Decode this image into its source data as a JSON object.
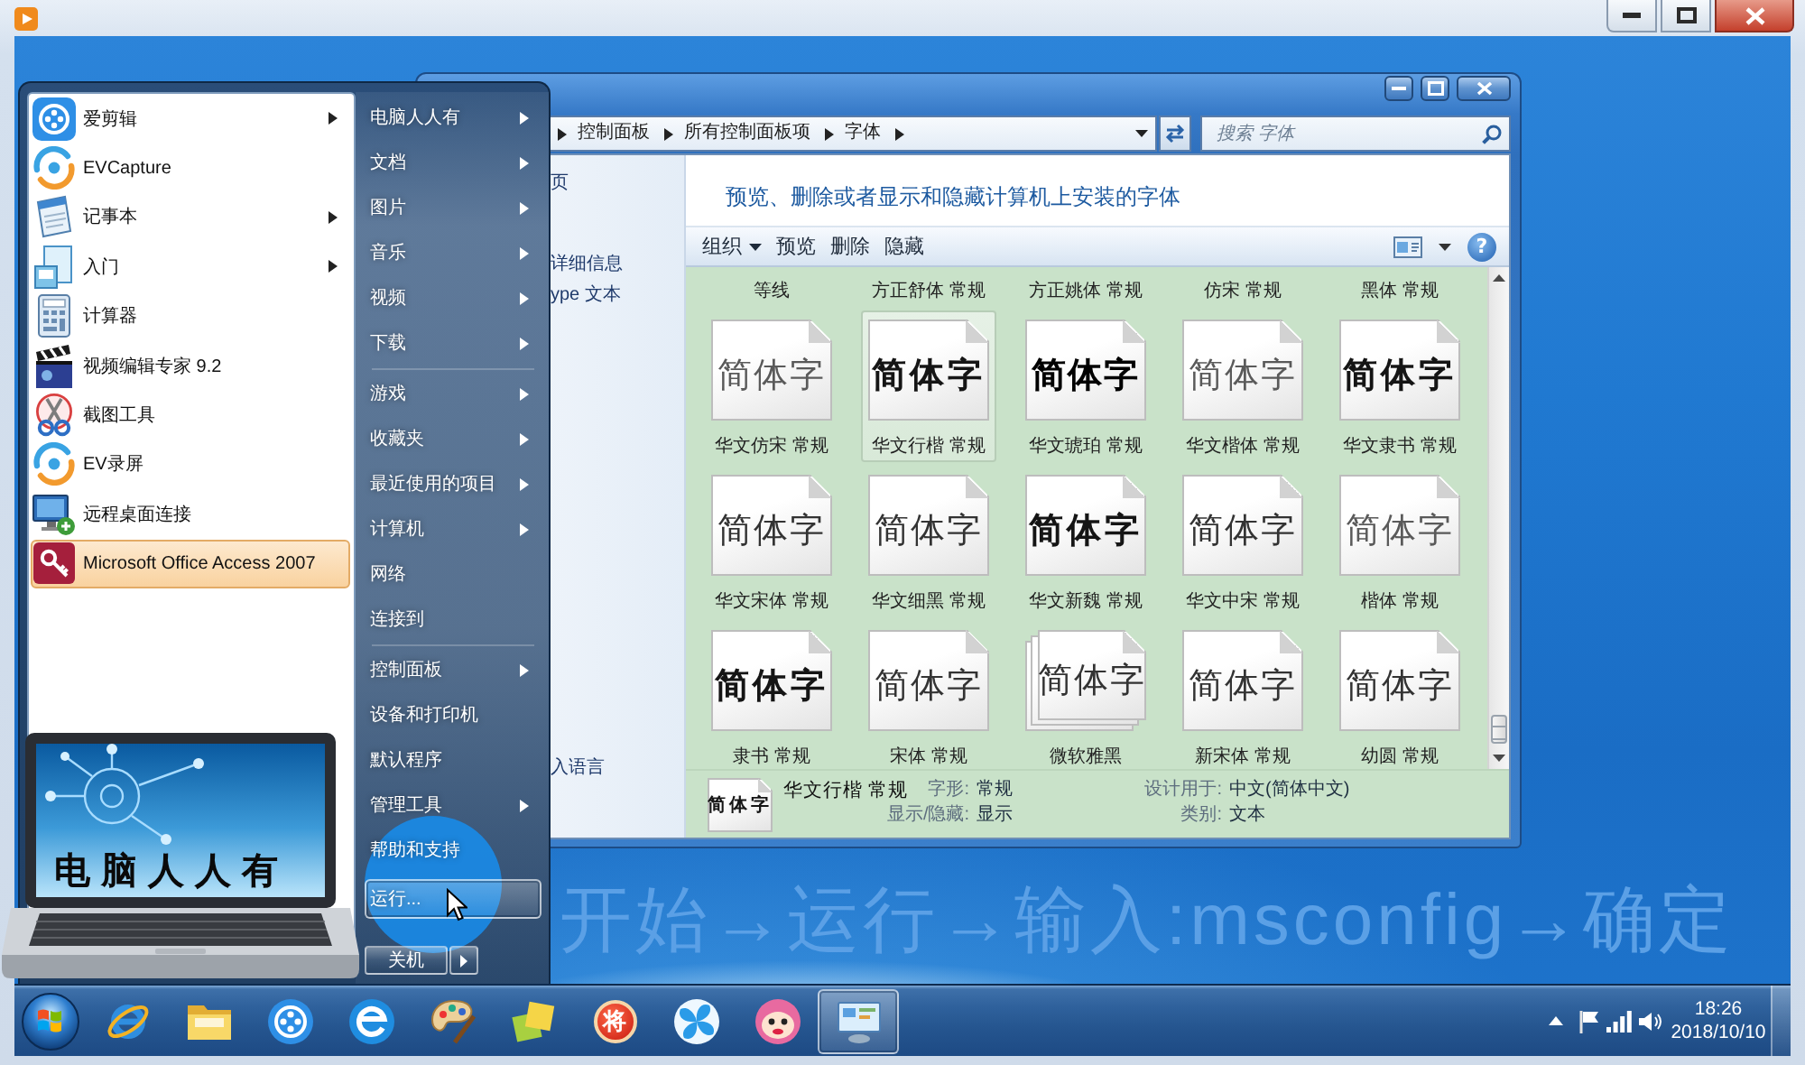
{
  "start_menu": {
    "programs": [
      {
        "label": "爱剪辑",
        "kind": "reel",
        "submenu": true,
        "selected": false
      },
      {
        "label": "EVCapture",
        "kind": "swirl",
        "submenu": false,
        "selected": false
      },
      {
        "label": "记事本",
        "kind": "notepad",
        "submenu": true,
        "selected": false
      },
      {
        "label": "入门",
        "kind": "welcome",
        "submenu": true,
        "selected": false
      },
      {
        "label": "计算器",
        "kind": "calculator",
        "submenu": false,
        "selected": false
      },
      {
        "label": "视频编辑专家 9.2",
        "kind": "clapper",
        "submenu": false,
        "selected": false
      },
      {
        "label": "截图工具",
        "kind": "scissors",
        "submenu": false,
        "selected": false
      },
      {
        "label": "EV录屏",
        "kind": "swirl",
        "submenu": false,
        "selected": false
      },
      {
        "label": "远程桌面连接",
        "kind": "monitor",
        "submenu": false,
        "selected": false
      },
      {
        "label": "Microsoft Office Access 2007",
        "kind": "key",
        "submenu": false,
        "selected": true
      }
    ],
    "place_groups": [
      {
        "items": [
          {
            "label": "电脑人人有",
            "submenu": true,
            "selected": false
          },
          {
            "label": "文档",
            "submenu": true,
            "selected": false
          },
          {
            "label": "图片",
            "submenu": true,
            "selected": false
          },
          {
            "label": "音乐",
            "submenu": true,
            "selected": false
          },
          {
            "label": "视频",
            "submenu": true,
            "selected": false
          },
          {
            "label": "下载",
            "submenu": true,
            "selected": false
          }
        ]
      },
      {
        "items": [
          {
            "label": "游戏",
            "submenu": true,
            "selected": false
          },
          {
            "label": "收藏夹",
            "submenu": true,
            "selected": false
          },
          {
            "label": "最近使用的项目",
            "submenu": true,
            "selected": false
          },
          {
            "label": "计算机",
            "submenu": true,
            "selected": false
          },
          {
            "label": "网络",
            "submenu": false,
            "selected": false
          },
          {
            "label": "连接到",
            "submenu": false,
            "selected": false
          }
        ]
      },
      {
        "items": [
          {
            "label": "控制面板",
            "submenu": true,
            "selected": false
          },
          {
            "label": "设备和打印机",
            "submenu": false,
            "selected": false
          },
          {
            "label": "默认程序",
            "submenu": false,
            "selected": false
          },
          {
            "label": "管理工具",
            "submenu": true,
            "selected": false
          },
          {
            "label": "帮助和支持",
            "submenu": false,
            "selected": false
          },
          {
            "label": "运行...",
            "submenu": false,
            "selected": true
          }
        ]
      }
    ],
    "shutdown": {
      "label": "关机"
    }
  },
  "fonts_window": {
    "breadcrumbs": [
      "控制面板",
      "所有控制面板项",
      "字体"
    ],
    "search": {
      "placeholder": "搜索 字体"
    },
    "side_links": [
      "页",
      "详细信息",
      "ype 文本"
    ],
    "side_see_also": [
      "入语言"
    ],
    "heading": "预览、删除或者显示和隐藏计算机上安装的字体",
    "toolbar": [
      {
        "label": "组织",
        "dropdown": true
      },
      {
        "label": "预览",
        "dropdown": false
      },
      {
        "label": "删除",
        "dropdown": false
      },
      {
        "label": "隐藏",
        "dropdown": false
      }
    ],
    "help": {
      "label": "?"
    },
    "partial_row": [
      "等线",
      "方正舒体 常规",
      "方正姚体 常规",
      "仿宋 常规",
      "黑体 常规"
    ],
    "fonts": [
      {
        "name": "华文仿宋 常规",
        "sample": "简体字",
        "kind": "light",
        "stacked": false,
        "selected": false
      },
      {
        "name": "华文行楷 常规",
        "sample": "简体字",
        "kind": "brush",
        "stacked": false,
        "selected": true
      },
      {
        "name": "华文琥珀 常规",
        "sample": "简体字",
        "kind": "heavy",
        "stacked": false,
        "selected": false
      },
      {
        "name": "华文楷体 常规",
        "sample": "简体字",
        "kind": "light",
        "stacked": false,
        "selected": false
      },
      {
        "name": "华文隶书 常规",
        "sample": "简体字",
        "kind": "brush",
        "stacked": false,
        "selected": false
      },
      {
        "name": "华文宋体 常规",
        "sample": "简体字",
        "kind": "song",
        "stacked": false,
        "selected": false
      },
      {
        "name": "华文细黑 常规",
        "sample": "简体字",
        "kind": "sans",
        "stacked": false,
        "selected": false
      },
      {
        "name": "华文新魏 常规",
        "sample": "简体字",
        "kind": "brush",
        "stacked": false,
        "selected": false
      },
      {
        "name": "华文中宋 常规",
        "sample": "简体字",
        "kind": "song",
        "stacked": false,
        "selected": false
      },
      {
        "name": "楷体 常规",
        "sample": "简体字",
        "kind": "light",
        "stacked": false,
        "selected": false
      },
      {
        "name": "隶书 常规",
        "sample": "简体字",
        "kind": "brush",
        "stacked": false,
        "selected": false
      },
      {
        "name": "宋体 常规",
        "sample": "简体字",
        "kind": "song",
        "stacked": false,
        "selected": false
      },
      {
        "name": "微软雅黑",
        "sample": "简体字",
        "kind": "sans",
        "stacked": true,
        "selected": false
      },
      {
        "name": "新宋体 常规",
        "sample": "简体字",
        "kind": "song",
        "stacked": false,
        "selected": false
      },
      {
        "name": "幼圆 常规",
        "sample": "简体字",
        "kind": "sans",
        "stacked": false,
        "selected": false
      }
    ],
    "details": {
      "sample": "简体字",
      "kind": "brush",
      "name": "华文行楷 常规",
      "fields": [
        {
          "label": "字形:",
          "value": "常规"
        },
        {
          "label": "设计用于:",
          "value": "中文(简体中文)"
        },
        {
          "label": "显示/隐藏:",
          "value": "显示"
        },
        {
          "label": "类别:",
          "value": "文本"
        }
      ]
    }
  },
  "taskbar": {
    "apps": [
      {
        "kind": "browser",
        "selected": false
      },
      {
        "kind": "folder",
        "selected": false
      },
      {
        "kind": "reel",
        "selected": false
      },
      {
        "kind": "globe",
        "selected": false
      },
      {
        "kind": "palette",
        "selected": false
      },
      {
        "kind": "notes",
        "selected": false
      },
      {
        "kind": "chess",
        "glyph": "将",
        "selected": false
      },
      {
        "kind": "pinwheel",
        "selected": false
      },
      {
        "kind": "face",
        "selected": false
      },
      {
        "kind": "panel",
        "selected": true
      }
    ],
    "clock": {
      "time": "18:26",
      "date": "2018/10/10"
    }
  },
  "overlay": {
    "logo_text": "电脑人人有",
    "caption": "开始→运行→输入:msconfig→确定"
  }
}
